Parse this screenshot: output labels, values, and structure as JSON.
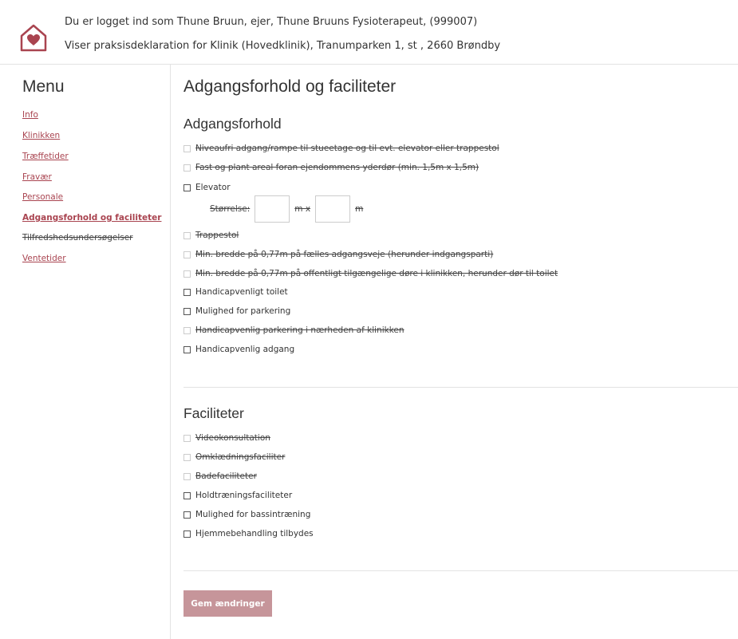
{
  "header": {
    "logged_in_line": "Du er logget ind som Thune Bruun, ejer, Thune Bruuns Fysioterapeut, (999007)",
    "showing_line": "Viser praksisdeklaration for Klinik (Hovedklinik), Tranumparken 1, st , 2660 Brøndby"
  },
  "sidebar": {
    "title": "Menu",
    "items": [
      {
        "label": "Info"
      },
      {
        "label": "Klinikken"
      },
      {
        "label": "Træffetider"
      },
      {
        "label": "Fravær"
      },
      {
        "label": "Personale"
      },
      {
        "label": "Adgangsforhold og faciliteter"
      },
      {
        "label": "Tilfredshedsundersøgelser"
      },
      {
        "label": "Ventetider"
      }
    ]
  },
  "main": {
    "title": "Adgangsforhold og faciliteter",
    "access": {
      "title": "Adgangsforhold",
      "items": [
        {
          "label": "Niveaufri adgang/rampe til stueetage og til evt. elevator eller trappestol"
        },
        {
          "label": "Fast og plant areal foran ejendommens yderdør (min. 1,5m x 1,5m)"
        },
        {
          "label": "Elevator"
        },
        {
          "label": "Trappestol"
        },
        {
          "label": "Min. bredde på 0,77m på fælles adgangsveje (herunder indgangsparti)"
        },
        {
          "label": "Min. bredde på 0,77m på offentligt tilgængelige døre i klinikken, herunder dør til toilet"
        },
        {
          "label": "Handicapvenligt toilet"
        },
        {
          "label": "Mulighed for parkering"
        },
        {
          "label": "Handicapvenlig parkering i nærheden af klinikken"
        },
        {
          "label": "Handicapvenlig adgang"
        }
      ],
      "size": {
        "label": "Størrelse:",
        "unit_x": "m x",
        "unit_m": "m",
        "width_value": "",
        "depth_value": ""
      }
    },
    "facilities": {
      "title": "Faciliteter",
      "items": [
        {
          "label": "Videokonsultation"
        },
        {
          "label": "Omklædningsfaciliter"
        },
        {
          "label": "Badefaciliteter"
        },
        {
          "label": "Holdtræningsfaciliteter"
        },
        {
          "label": "Mulighed for bassintræning"
        },
        {
          "label": "Hjemmebehandling tilbydes"
        }
      ]
    },
    "save_label": "Gem ændringer"
  },
  "colors": {
    "accent": "#a94450",
    "button": "#c6959a",
    "border": "#e3e3e3"
  }
}
